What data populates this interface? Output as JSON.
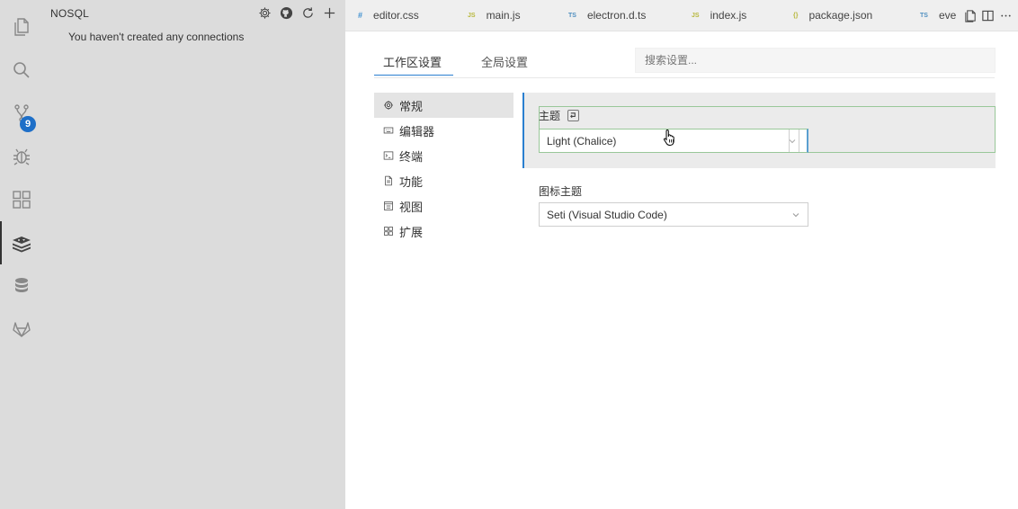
{
  "sidebar": {
    "title": "NOSQL",
    "empty_message": "You haven't created any connections"
  },
  "activity_bar": {
    "badge_count": "9"
  },
  "tabs": [
    {
      "label": "editor.css",
      "icon": "#",
      "kind": "css"
    },
    {
      "label": "main.js",
      "icon": "JS",
      "kind": "js"
    },
    {
      "label": "electron.d.ts",
      "icon": "TS",
      "kind": "ts"
    },
    {
      "label": "index.js",
      "icon": "JS",
      "kind": "js"
    },
    {
      "label": "package.json",
      "icon": "{}",
      "kind": "json"
    },
    {
      "label": "eve",
      "icon": "TS",
      "kind": "ts"
    }
  ],
  "settings": {
    "tab_workspace": "工作区设置",
    "tab_user": "全局设置",
    "search_placeholder": "搜索设置...",
    "toc": [
      {
        "label": "常规",
        "icon": "gear-icon"
      },
      {
        "label": "编辑器",
        "icon": "keyboard-icon"
      },
      {
        "label": "终端",
        "icon": "terminal-icon"
      },
      {
        "label": "功能",
        "icon": "file-icon"
      },
      {
        "label": "视图",
        "icon": "window-icon"
      },
      {
        "label": "扩展",
        "icon": "extensions-icon"
      }
    ],
    "theme_label": "主题",
    "theme_value": "Light (Chalice)",
    "icon_theme_label": "图标主题",
    "icon_theme_value": "Seti (Visual Studio Code)"
  },
  "colors": {
    "accent": "#2a7fd0",
    "badge": "#1e6fc8",
    "focus_border": "#99c799"
  }
}
